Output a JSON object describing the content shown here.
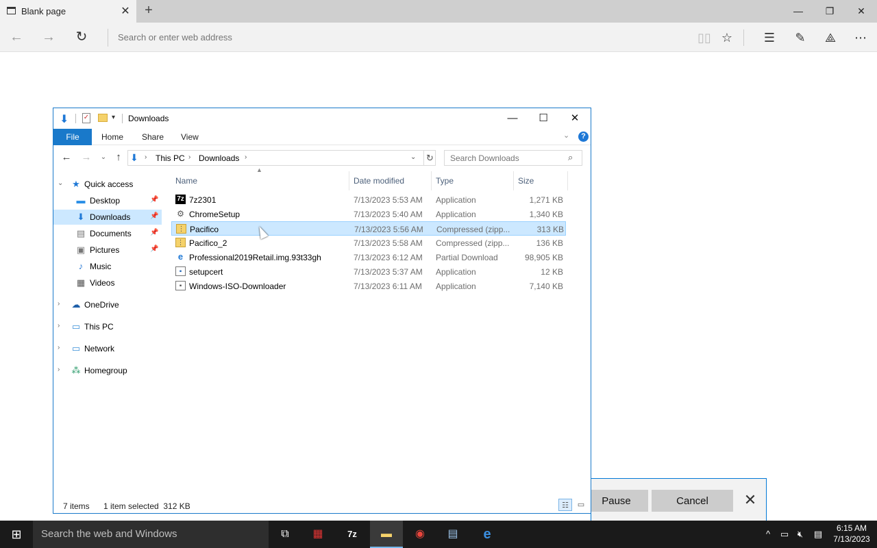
{
  "browser": {
    "tab_title": "Blank page",
    "address_placeholder": "Search or enter web address"
  },
  "download_bar": {
    "pause_label": "Pause",
    "cancel_label": "Cancel"
  },
  "explorer": {
    "title": "Downloads",
    "ribbon": {
      "file": "File",
      "home": "Home",
      "share": "Share",
      "view": "View"
    },
    "breadcrumb": [
      "This PC",
      "Downloads"
    ],
    "search_placeholder": "Search Downloads",
    "nav": {
      "quick_access": "Quick access",
      "desktop": "Desktop",
      "downloads": "Downloads",
      "documents": "Documents",
      "pictures": "Pictures",
      "music": "Music",
      "videos": "Videos",
      "onedrive": "OneDrive",
      "this_pc": "This PC",
      "network": "Network",
      "homegroup": "Homegroup"
    },
    "columns": {
      "name": "Name",
      "date": "Date modified",
      "type": "Type",
      "size": "Size"
    },
    "files": [
      {
        "name": "7z2301",
        "date": "7/13/2023 5:53 AM",
        "type": "Application",
        "size": "1,271 KB",
        "icon": "7zip-icon"
      },
      {
        "name": "ChromeSetup",
        "date": "7/13/2023 5:40 AM",
        "type": "Application",
        "size": "1,340 KB",
        "icon": "setup-icon"
      },
      {
        "name": "Pacifico",
        "date": "7/13/2023 5:56 AM",
        "type": "Compressed (zipp...",
        "size": "313 KB",
        "icon": "zip-folder-icon"
      },
      {
        "name": "Pacifico_2",
        "date": "7/13/2023 5:58 AM",
        "type": "Compressed (zipp...",
        "size": "136 KB",
        "icon": "zip-folder-icon"
      },
      {
        "name": "Professional2019Retail.img.93t33gh",
        "date": "7/13/2023 6:12 AM",
        "type": "Partial Download",
        "size": "98,905 KB",
        "icon": "edge-file-icon"
      },
      {
        "name": "setupcert",
        "date": "7/13/2023 5:37 AM",
        "type": "Application",
        "size": "12 KB",
        "icon": "app-icon"
      },
      {
        "name": "Windows-ISO-Downloader",
        "date": "7/13/2023 6:11 AM",
        "type": "Application",
        "size": "7,140 KB",
        "icon": "app-icon"
      }
    ],
    "status": {
      "items": "7 items",
      "selected": "1 item selected  312 KB"
    }
  },
  "taskbar": {
    "search_placeholder": "Search the web and Windows",
    "time": "6:15 AM",
    "date": "7/13/2023"
  },
  "colors": {
    "accent": "#1979ca",
    "selection": "#cce8ff",
    "taskbar": "#1a1a1a"
  }
}
